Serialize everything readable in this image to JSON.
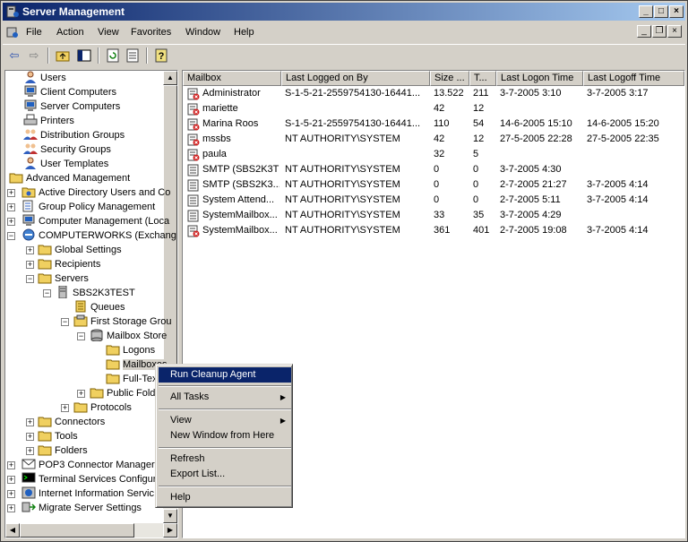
{
  "window": {
    "title": "Server Management"
  },
  "menubar": {
    "items": [
      "File",
      "Action",
      "View",
      "Favorites",
      "Window",
      "Help"
    ]
  },
  "tree": {
    "items": [
      {
        "label": "Users",
        "icon": "user-icon"
      },
      {
        "label": "Client Computers",
        "icon": "computer-icon"
      },
      {
        "label": "Server Computers",
        "icon": "computer-icon"
      },
      {
        "label": "Printers",
        "icon": "printer-icon"
      },
      {
        "label": "Distribution Groups",
        "icon": "group-icon"
      },
      {
        "label": "Security Groups",
        "icon": "group-icon"
      },
      {
        "label": "User Templates",
        "icon": "user-icon"
      },
      {
        "label": "Advanced Management",
        "icon": "folder-icon"
      },
      {
        "label": "Active Directory Users and Co",
        "icon": "ad-icon"
      },
      {
        "label": "Group Policy Management",
        "icon": "policy-icon"
      },
      {
        "label": "Computer Management (Loca",
        "icon": "computer-icon"
      },
      {
        "label": "COMPUTERWORKS (Exchang",
        "icon": "exchange-icon"
      },
      {
        "label": "Global Settings",
        "icon": "folder-icon"
      },
      {
        "label": "Recipients",
        "icon": "folder-icon"
      },
      {
        "label": "Servers",
        "icon": "folder-icon"
      },
      {
        "label": "SBS2K3TEST",
        "icon": "server-icon"
      },
      {
        "label": "Queues",
        "icon": "queue-icon"
      },
      {
        "label": "First Storage Grou",
        "icon": "storage-icon"
      },
      {
        "label": "Mailbox Store",
        "icon": "store-icon"
      },
      {
        "label": "Logons",
        "icon": "folder-icon"
      },
      {
        "label": "Mailboxes",
        "icon": "folder-icon"
      },
      {
        "label": "Full-Tex",
        "icon": "folder-icon"
      },
      {
        "label": "Public Folde",
        "icon": "folder-icon"
      },
      {
        "label": "Protocols",
        "icon": "folder-icon"
      },
      {
        "label": "Connectors",
        "icon": "folder-icon"
      },
      {
        "label": "Tools",
        "icon": "folder-icon"
      },
      {
        "label": "Folders",
        "icon": "folder-icon"
      },
      {
        "label": "POP3 Connector Manager",
        "icon": "pop3-icon"
      },
      {
        "label": "Terminal Services Configura",
        "icon": "terminal-icon"
      },
      {
        "label": "Internet Information Servic",
        "icon": "iis-icon"
      },
      {
        "label": "Migrate Server Settings",
        "icon": "migrate-icon"
      }
    ]
  },
  "list": {
    "columns": [
      "Mailbox",
      "Last Logged on By",
      "Size ...",
      "T...",
      "Last Logon Time",
      "Last Logoff Time"
    ],
    "rows": [
      [
        "Administrator",
        "S-1-5-21-2559754130-16441...",
        "13.522",
        "211",
        "3-7-2005 3:10",
        "3-7-2005 3:17"
      ],
      [
        "mariette",
        "",
        "42",
        "12",
        "",
        ""
      ],
      [
        "Marina Roos",
        "S-1-5-21-2559754130-16441...",
        "110",
        "54",
        "14-6-2005 15:10",
        "14-6-2005 15:20"
      ],
      [
        "mssbs",
        "NT AUTHORITY\\SYSTEM",
        "42",
        "12",
        "27-5-2005 22:28",
        "27-5-2005 22:35"
      ],
      [
        "paula",
        "",
        "32",
        "5",
        "",
        ""
      ],
      [
        "SMTP (SBS2K3TES...",
        "NT AUTHORITY\\SYSTEM",
        "0",
        "0",
        "3-7-2005 4:30",
        ""
      ],
      [
        "SMTP (SBS2K3...",
        "NT AUTHORITY\\SYSTEM",
        "0",
        "0",
        "2-7-2005 21:27",
        "3-7-2005 4:14"
      ],
      [
        "System Attend...",
        "NT AUTHORITY\\SYSTEM",
        "0",
        "0",
        "2-7-2005 5:11",
        "3-7-2005 4:14"
      ],
      [
        "SystemMailbox...",
        "NT AUTHORITY\\SYSTEM",
        "33",
        "35",
        "3-7-2005 4:29",
        ""
      ],
      [
        "SystemMailbox...",
        "NT AUTHORITY\\SYSTEM",
        "361",
        "401",
        "2-7-2005 19:08",
        "3-7-2005 4:14"
      ]
    ]
  },
  "context_menu": {
    "run_cleanup": "Run Cleanup Agent",
    "all_tasks": "All Tasks",
    "view": "View",
    "new_window": "New Window from Here",
    "refresh": "Refresh",
    "export_list": "Export List...",
    "help": "Help"
  }
}
